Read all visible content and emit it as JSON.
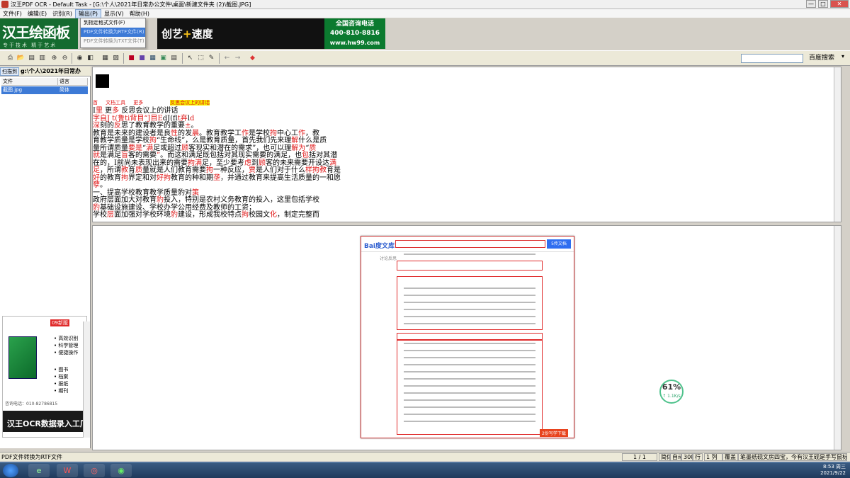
{
  "window": {
    "title": "汉王PDF OCR - Default Task - [G:\\个人\\2021年日常办公文件\\桌面\\新建文件夹 (2)\\截图.JPG]",
    "min": "—",
    "max": "□",
    "close": "✕"
  },
  "menu": [
    "文件(F)",
    "编辑(E)",
    "识别(R)",
    "输出(P)",
    "显示(V)",
    "帮助(H)"
  ],
  "dropdown": [
    "到指定格式文件(F)",
    "PDF文件转换为RTF文件(R)",
    "PDF文件转换为TXT文件(T)"
  ],
  "banner": {
    "logo": "汉王绘函板",
    "logo_sub": "专于技术 精于艺术",
    "slogan_a": "创艺",
    "slogan_plus": "+",
    "slogan_b": "速度",
    "hotline_label": "全国咨询电话",
    "hotline_number": "400-810-8816",
    "site": "www.hw99.com"
  },
  "search": {
    "button": "百度搜索",
    "value": ""
  },
  "left_panel": {
    "tab": "扫描到",
    "path": "g:\\个人\\2021年日常办",
    "columns": [
      "文件",
      "语言"
    ],
    "file": {
      "name": "截图.jpg",
      "lang": "简体"
    },
    "ad": {
      "tag": "09新版",
      "features": [
        "• 高效识别",
        "• 科学管理",
        "• 便捷操作"
      ],
      "types": [
        "• 图书",
        "• 档案",
        "• 报纸",
        "• 期刊"
      ],
      "phone": "咨询电话：010-82786815",
      "brand": "汉王OCR数据录入工厂"
    }
  },
  "ocr": {
    "toolbar_line": [
      "首",
      "文档工具",
      "更多",
      "反思会议上的讲话"
    ],
    "lines": [
      [
        {
          "t": "I"
        },
        {
          "t": "里",
          "r": 1
        },
        {
          "t": "  更"
        },
        {
          "t": "多",
          "r": 1
        },
        {
          "t": "    反思会议上的讲话"
        }
      ],
      [
        {
          "t": "  "
        },
        {
          "t": "字自J t(",
          "r": 1
        },
        {
          "t": "鲁",
          "r": 1
        },
        {
          "t": "ti",
          "r": 1
        },
        {
          "t": "背目“J目E",
          "r": 1
        },
        {
          "t": "dJ(fl"
        },
        {
          "t": "t弃",
          "r": 1
        },
        {
          "t": "l"
        },
        {
          "t": "d",
          "r": 1
        }
      ],
      [
        {
          "t": "深",
          "r": 1
        },
        {
          "t": "刻的"
        },
        {
          "t": "反",
          "r": 1
        },
        {
          "t": "思了教育教学的重要"
        },
        {
          "t": "±",
          "r": 1
        },
        {
          "t": "。"
        }
      ],
      [
        {
          "t": "  教育是未来的建设者是良"
        },
        {
          "t": "性",
          "r": 1
        },
        {
          "t": "的发"
        },
        {
          "t": "晨",
          "r": 1
        },
        {
          "t": "。教育教学工"
        },
        {
          "t": "作",
          "r": 1
        },
        {
          "t": "是学校"
        },
        {
          "t": "拘",
          "r": 1
        },
        {
          "t": "中心工"
        },
        {
          "t": "作",
          "r": 1
        },
        {
          "t": "，教"
        }
      ],
      [
        {
          "t": "育教学质量是学校"
        },
        {
          "t": "拘",
          "r": 1
        },
        {
          "t": "“生命线”，么是教育质量，首先我们先来理"
        },
        {
          "t": "解",
          "r": 1
        },
        {
          "t": "什么是质"
        }
      ],
      [
        {
          "t": "量所谓质量"
        },
        {
          "t": "要是",
          "r": 1
        },
        {
          "t": "“"
        },
        {
          "t": "满",
          "r": 1
        },
        {
          "t": "足或超过"
        },
        {
          "t": "顾",
          "r": 1
        },
        {
          "t": "客现实和潜在的需求”，也可以理"
        },
        {
          "t": "解为",
          "r": 1
        },
        {
          "t": "“"
        },
        {
          "t": "质",
          "r": 1
        }
      ],
      [
        {
          "t": "就",
          "r": 1
        },
        {
          "t": "是满足"
        },
        {
          "t": "盲",
          "r": 1
        },
        {
          "t": "客的需要"
        },
        {
          "t": "”",
          "r": 1
        },
        {
          "t": "。而这和满足既包括对其现实需要的满足，也"
        },
        {
          "t": "包",
          "r": 1
        },
        {
          "t": "括对其潜"
        }
      ],
      [
        {
          "t": "在的，I前尚未表现出来的需要"
        },
        {
          "t": "拘满",
          "r": 1
        },
        {
          "t": "足，至少要考"
        },
        {
          "t": "虑",
          "r": 1
        },
        {
          "t": "到"
        },
        {
          "t": "顾",
          "r": 1
        },
        {
          "t": "客的未来需要开设达"
        },
        {
          "t": "满",
          "r": 1
        }
      ],
      [
        {
          "t": "足",
          "r": 1
        },
        {
          "t": "，所谓"
        },
        {
          "t": "教",
          "r": 1
        },
        {
          "t": "育"
        },
        {
          "t": "质",
          "r": 1
        },
        {
          "t": "量就是人们教育需要"
        },
        {
          "t": "拘",
          "r": 1
        },
        {
          "t": "一种反应，"
        },
        {
          "t": "贾",
          "r": 1
        },
        {
          "t": "是人们对于什么"
        },
        {
          "t": "样拘教",
          "r": 1
        },
        {
          "t": "育是"
        }
      ],
      [
        {
          "t": "好",
          "r": 1
        },
        {
          "t": "的教育"
        },
        {
          "t": "拘",
          "r": 1
        },
        {
          "t": "界定和对"
        },
        {
          "t": "好",
          "r": 1
        },
        {
          "t": "拘",
          "r": 1
        },
        {
          "t": "教育的种和期"
        },
        {
          "t": "垄",
          "r": 1
        },
        {
          "t": "，并通过教育来提高生活质量的一和愿"
        }
      ],
      [
        {
          "t": "孽",
          "r": 1
        },
        {
          "t": "。"
        }
      ],
      [
        {
          "t": "一、提高学校教育教学质量豹对"
        },
        {
          "t": "策",
          "r": 1
        }
      ],
      [
        {
          "t": "  政府层面加大对教育"
        },
        {
          "t": "豹",
          "r": 1
        },
        {
          "t": "投入，特别是农村义务教育的投入，这里包括学校"
        }
      ],
      [
        {
          "t": "豹",
          "r": 1
        },
        {
          "t": "基础设施建设、学校办学公用经费及教师的工资；"
        }
      ],
      [
        {
          "t": "  学校"
        },
        {
          "t": "层",
          "r": 1
        },
        {
          "t": "面加强对学校环境"
        },
        {
          "t": "豹",
          "r": 1
        },
        {
          "t": "建设，形成我校特点"
        },
        {
          "t": "拘",
          "r": 1
        },
        {
          "t": "校园文"
        },
        {
          "t": "化",
          "r": 1
        },
        {
          "t": "，制定完整而"
        }
      ]
    ]
  },
  "preview": {
    "doc_logo": "Bai度文库",
    "doc_button": "5传文档",
    "side_label": "讨论反思",
    "footer_button": "2份写学下载"
  },
  "progress": {
    "percent": "61%",
    "speed": "↑ 1.1K/s",
    "value": 61
  },
  "status": {
    "left": "PDF文件转换为RTF文件",
    "page": "1 / 1",
    "mode": "简体",
    "layout": "自动",
    "resolution": "300",
    "line_label": "行",
    "col": "1 列",
    "overwrite": "覆盖",
    "tip": "笔墨纸砚文房四宝，今有汉王砚是手写鼠标！"
  },
  "taskbar": {
    "apps": [
      "e",
      "W",
      "◎",
      "◉"
    ],
    "time": "8:53 周三",
    "date": "2021/9/22"
  },
  "colors": {
    "ocr_error": "#e01818",
    "banner_green": "#156b2f",
    "selection": "#3d7ad6"
  }
}
